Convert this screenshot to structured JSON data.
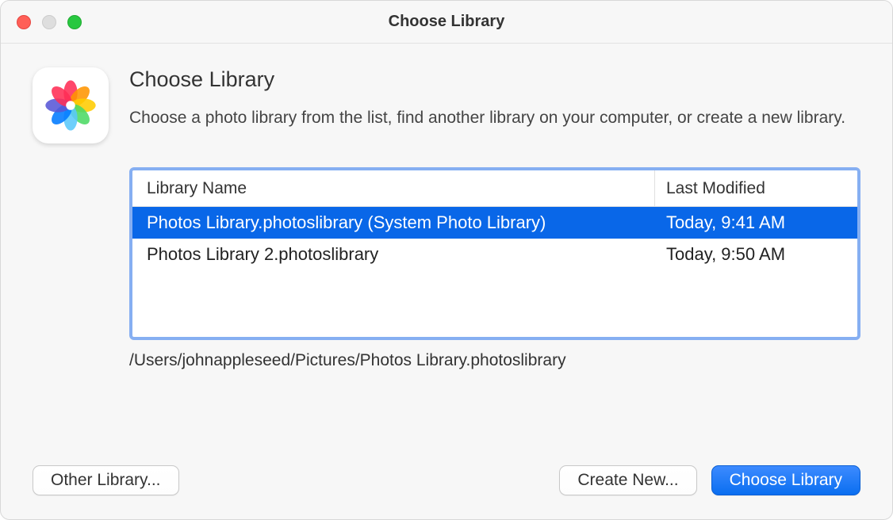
{
  "window": {
    "title": "Choose Library"
  },
  "header": {
    "heading": "Choose Library",
    "description": "Choose a photo library from the list, find another library on your computer, or create a new library."
  },
  "table": {
    "columns": {
      "name": "Library Name",
      "modified": "Last Modified"
    },
    "rows": [
      {
        "name": "Photos Library.photoslibrary (System Photo Library)",
        "modified": "Today, 9:41 AM",
        "selected": true
      },
      {
        "name": "Photos Library 2.photoslibrary",
        "modified": "Today, 9:50 AM",
        "selected": false
      }
    ]
  },
  "path": "/Users/johnappleseed/Pictures/Photos Library.photoslibrary",
  "buttons": {
    "other": "Other Library...",
    "create": "Create New...",
    "choose": "Choose Library"
  }
}
